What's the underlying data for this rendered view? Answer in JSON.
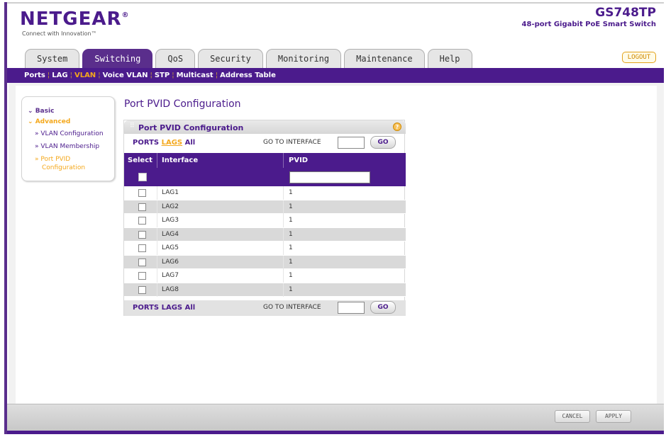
{
  "header": {
    "logo": "NETGEAR",
    "logo_mark": "®",
    "tagline": "Connect with Innovation™",
    "model_name": "GS748TP",
    "model_desc": "48-port Gigabit PoE Smart Switch"
  },
  "tabs": [
    {
      "label": "System",
      "active": false
    },
    {
      "label": "Switching",
      "active": true
    },
    {
      "label": "QoS",
      "active": false
    },
    {
      "label": "Security",
      "active": false
    },
    {
      "label": "Monitoring",
      "active": false
    },
    {
      "label": "Maintenance",
      "active": false
    },
    {
      "label": "Help",
      "active": false
    }
  ],
  "logout_label": "LOGOUT",
  "subnav": [
    {
      "label": "Ports",
      "active": false
    },
    {
      "label": "LAG",
      "active": false
    },
    {
      "label": "VLAN",
      "active": true
    },
    {
      "label": "Voice VLAN",
      "active": false
    },
    {
      "label": "STP",
      "active": false
    },
    {
      "label": "Multicast",
      "active": false
    },
    {
      "label": "Address Table",
      "active": false
    }
  ],
  "leftnav": {
    "basic": "Basic",
    "advanced": "Advanced",
    "items": [
      {
        "label": "» VLAN Configuration",
        "active": false
      },
      {
        "label": "» VLAN Membership",
        "active": false
      },
      {
        "label": "» Port PVID",
        "active": true
      },
      {
        "label": "Configuration",
        "active": true
      }
    ]
  },
  "page_title": "Port PVID Configuration",
  "box_title": "Port PVID Configuration",
  "help_icon": "?",
  "filter": {
    "ports": "PORTS",
    "lags": "LAGS",
    "all": "All",
    "goto_label": "GO TO INTERFACE",
    "go_label": "GO"
  },
  "columns": {
    "select": "Select",
    "interface": "Interface",
    "pvid": "PVID"
  },
  "rows": [
    {
      "interface": "LAG1",
      "pvid": "1"
    },
    {
      "interface": "LAG2",
      "pvid": "1"
    },
    {
      "interface": "LAG3",
      "pvid": "1"
    },
    {
      "interface": "LAG4",
      "pvid": "1"
    },
    {
      "interface": "LAG5",
      "pvid": "1"
    },
    {
      "interface": "LAG6",
      "pvid": "1"
    },
    {
      "interface": "LAG7",
      "pvid": "1"
    },
    {
      "interface": "LAG8",
      "pvid": "1"
    }
  ],
  "buttons": {
    "cancel": "CANCEL",
    "apply": "APPLY"
  },
  "colors": {
    "brand_purple": "#4b1b8c",
    "accent_orange": "#f4a81c"
  }
}
